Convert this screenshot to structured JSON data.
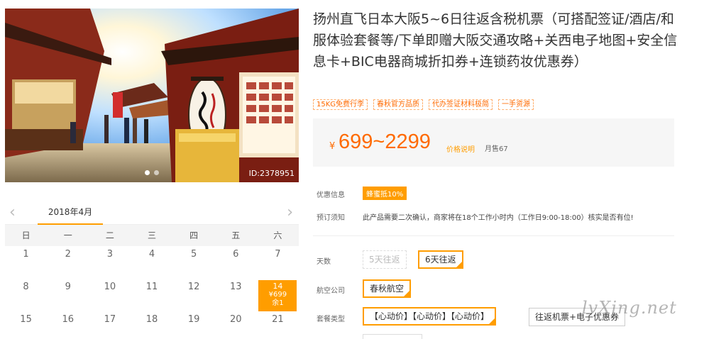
{
  "gallery": {
    "photo_id": "ID:2378951",
    "dots": 2,
    "active_dot": 0
  },
  "calendar": {
    "month_label": "2018年4月",
    "prev_icon": "‹",
    "next_icon": "›",
    "weekdays": [
      "日",
      "一",
      "二",
      "三",
      "四",
      "五",
      "六"
    ],
    "rows": [
      [
        "1",
        "2",
        "3",
        "4",
        "5",
        "6",
        "7"
      ],
      [
        "8",
        "9",
        "10",
        "11",
        "12",
        "13",
        "14"
      ],
      [
        "15",
        "16",
        "17",
        "18",
        "19",
        "20",
        "21"
      ]
    ],
    "available": {
      "day": "14",
      "price": "¥699",
      "remaining": "余1"
    }
  },
  "product": {
    "title": "扬州直飞日本大阪5~6日往返含税机票（可搭配签证/酒店/和服体验套餐等/下单即赠大阪交通攻略+关西电子地图+安全信息卡+BIC电器商城折扣券+连锁药妆优惠券）",
    "tags": [
      "15KG免费行李",
      "春秋官方品质",
      "代办签证材料极简",
      "一手资源"
    ],
    "price": {
      "currency": "¥",
      "range": "699~2299",
      "note": "价格说明",
      "monthly_sales": "月售67"
    },
    "promo": {
      "label": "优惠信息",
      "badge": "蜂蜜抵10%"
    },
    "notice": {
      "label": "预订须知",
      "text": "此产品需要二次确认，商家将在18个工作小时内（工作日9:00-18:00）核实是否有位!"
    },
    "days": {
      "label": "天数",
      "options": [
        "5天往返",
        "6天往返"
      ],
      "selected": "6天往返"
    },
    "airline": {
      "label": "航空公司",
      "options": [
        "春秋航空"
      ],
      "selected": "春秋航空"
    },
    "package": {
      "label": "套餐类型",
      "options": [
        "【心动价】【心动价】【心动价】",
        "往返机票+电子优惠券"
      ],
      "selected": "【心动价】【心动价】【心动价】"
    }
  },
  "watermark": "lvXing.net",
  "colors": {
    "accent": "#ff9d00",
    "price": "#ff6a00"
  }
}
